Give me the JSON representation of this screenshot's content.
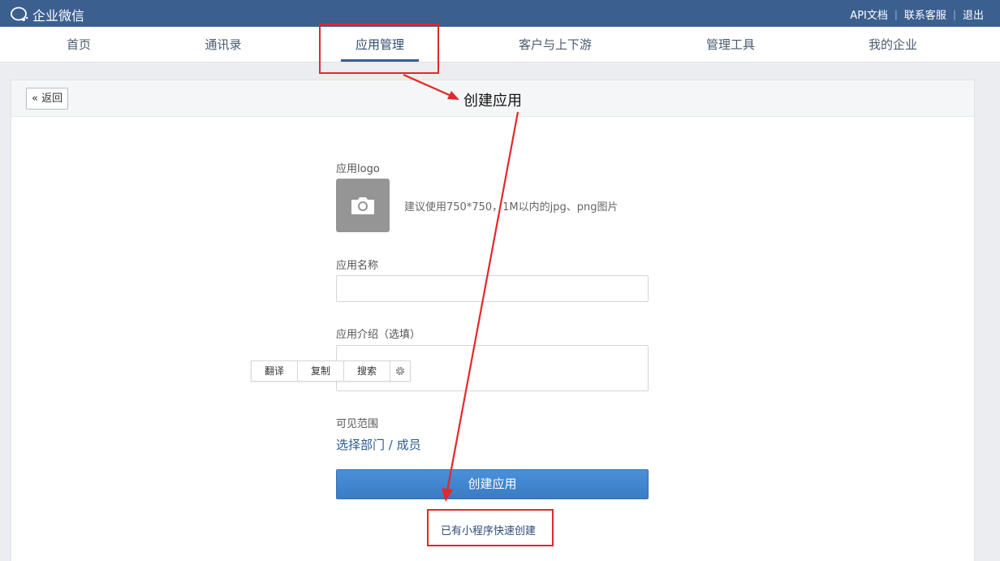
{
  "brand": {
    "name": "企业微信",
    "icon": "wecom-logo-icon"
  },
  "top_links": [
    "API文档",
    "联系客服",
    "退出"
  ],
  "nav": [
    {
      "label": "首页"
    },
    {
      "label": "通讯录"
    },
    {
      "label": "应用管理",
      "active": true
    },
    {
      "label": "客户与上下游"
    },
    {
      "label": "管理工具"
    },
    {
      "label": "我的企业"
    }
  ],
  "back_label": "返回",
  "form": {
    "logo_label": "应用logo",
    "logo_hint": "建议使用750*750，1M以内的jpg、png图片",
    "name_label": "应用名称",
    "name_value": "",
    "intro_label": "应用介绍（选填）",
    "intro_value": "",
    "scope_label": "可见范围",
    "scope_link": "选择部门 / 成员",
    "submit": "创建应用",
    "quick_create": "已有小程序快速创建"
  },
  "context_toolbar": [
    "翻译",
    "复制",
    "搜索"
  ],
  "annotation": {
    "text": "创建应用",
    "color": "#e4282a"
  },
  "colors": {
    "topbar": "#3b5f8f",
    "primary": "#3a7cc4",
    "link": "#2b5a91",
    "annotation": "#e4282a"
  }
}
